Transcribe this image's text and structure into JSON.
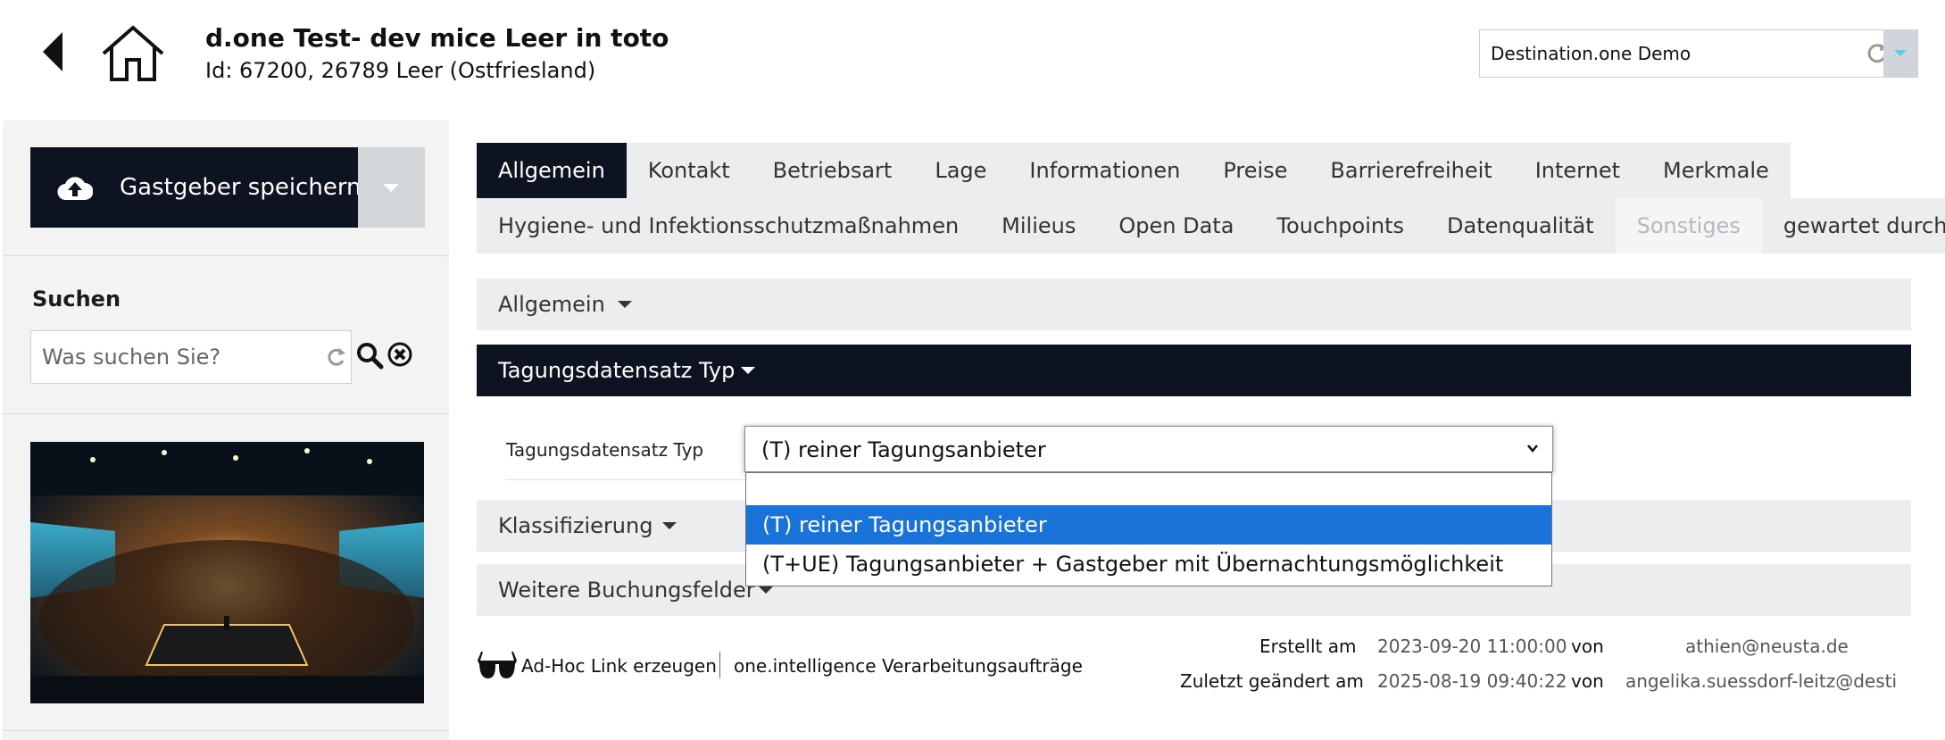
{
  "header": {
    "title": "d.one Test- dev mice Leer in toto",
    "subtitle": "Id: 67200, 26789 Leer (Ostfriesland)",
    "back_icon": "chevron-left-icon",
    "home_icon": "home-icon"
  },
  "destination": {
    "value": "Destination.one Demo"
  },
  "sidebar": {
    "save_label": "Gastgeber speichern",
    "search_title": "Suchen",
    "search_placeholder": "Was suchen Sie?"
  },
  "tabs_row1": [
    "Allgemein",
    "Kontakt",
    "Betriebsart",
    "Lage",
    "Informationen",
    "Preise",
    "Barrierefreiheit",
    "Internet",
    "Merkmale"
  ],
  "tabs_row2": [
    "Hygiene- und Infektionsschutzmaßnahmen",
    "Milieus",
    "Open Data",
    "Touchpoints",
    "Datenqualität",
    "Sonstiges",
    "gewartet durch"
  ],
  "sections": {
    "allgemein": "Allgemein",
    "tagung": "Tagungsdatensatz Typ",
    "klassifizierung": "Klassifizierung",
    "weitere": "Weitere Buchungsfelder"
  },
  "form": {
    "field_label": "Tagungsdatensatz Typ",
    "selected_value": "(T) reiner Tagungsanbieter",
    "options": [
      "",
      "(T) reiner Tagungsanbieter",
      "(T+UE) Tagungsanbieter + Gastgeber mit Übernachtungsmöglichkeit"
    ]
  },
  "footer": {
    "adhoc_link": "Ad-Hoc Link erzeugen",
    "intelligence_link": "one.intelligence Verarbeitungsaufträge",
    "created_label": "Erstellt am",
    "created_date": "2023-09-20 11:00:00",
    "created_von": "von",
    "created_by": "athien@neusta.de",
    "changed_label": "Zuletzt geändert am",
    "changed_date": "2025-08-19 09:40:22",
    "changed_von": "von",
    "changed_by": "angelika.suessdorf-leitz@destina"
  },
  "colors": {
    "dark": "#0d1321",
    "tab_bg": "#ebedef",
    "option_selected": "#1a73d9"
  }
}
